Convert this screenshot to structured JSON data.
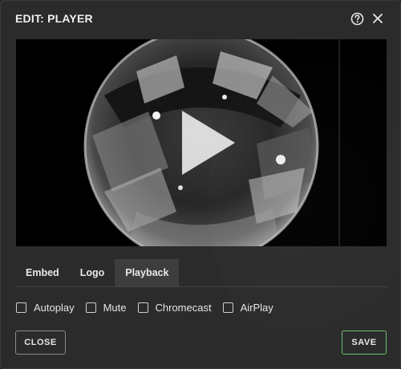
{
  "dialog": {
    "title": "EDIT: PLAYER",
    "icons": {
      "help": "help-circle-icon",
      "close": "close-icon"
    }
  },
  "video": {
    "icons": {
      "play": "play-icon"
    }
  },
  "tabs": [
    {
      "label": "Embed",
      "active": false
    },
    {
      "label": "Logo",
      "active": false
    },
    {
      "label": "Playback",
      "active": true
    }
  ],
  "options": [
    {
      "label": "Autoplay",
      "checked": false
    },
    {
      "label": "Mute",
      "checked": false
    },
    {
      "label": "Chromecast",
      "checked": false
    },
    {
      "label": "AirPlay",
      "checked": false
    }
  ],
  "footer": {
    "close_label": "CLOSE",
    "save_label": "SAVE"
  },
  "colors": {
    "background": "#2b2b2b",
    "save_accent": "#6cc36a",
    "active_tab": "#3d3d3d"
  }
}
